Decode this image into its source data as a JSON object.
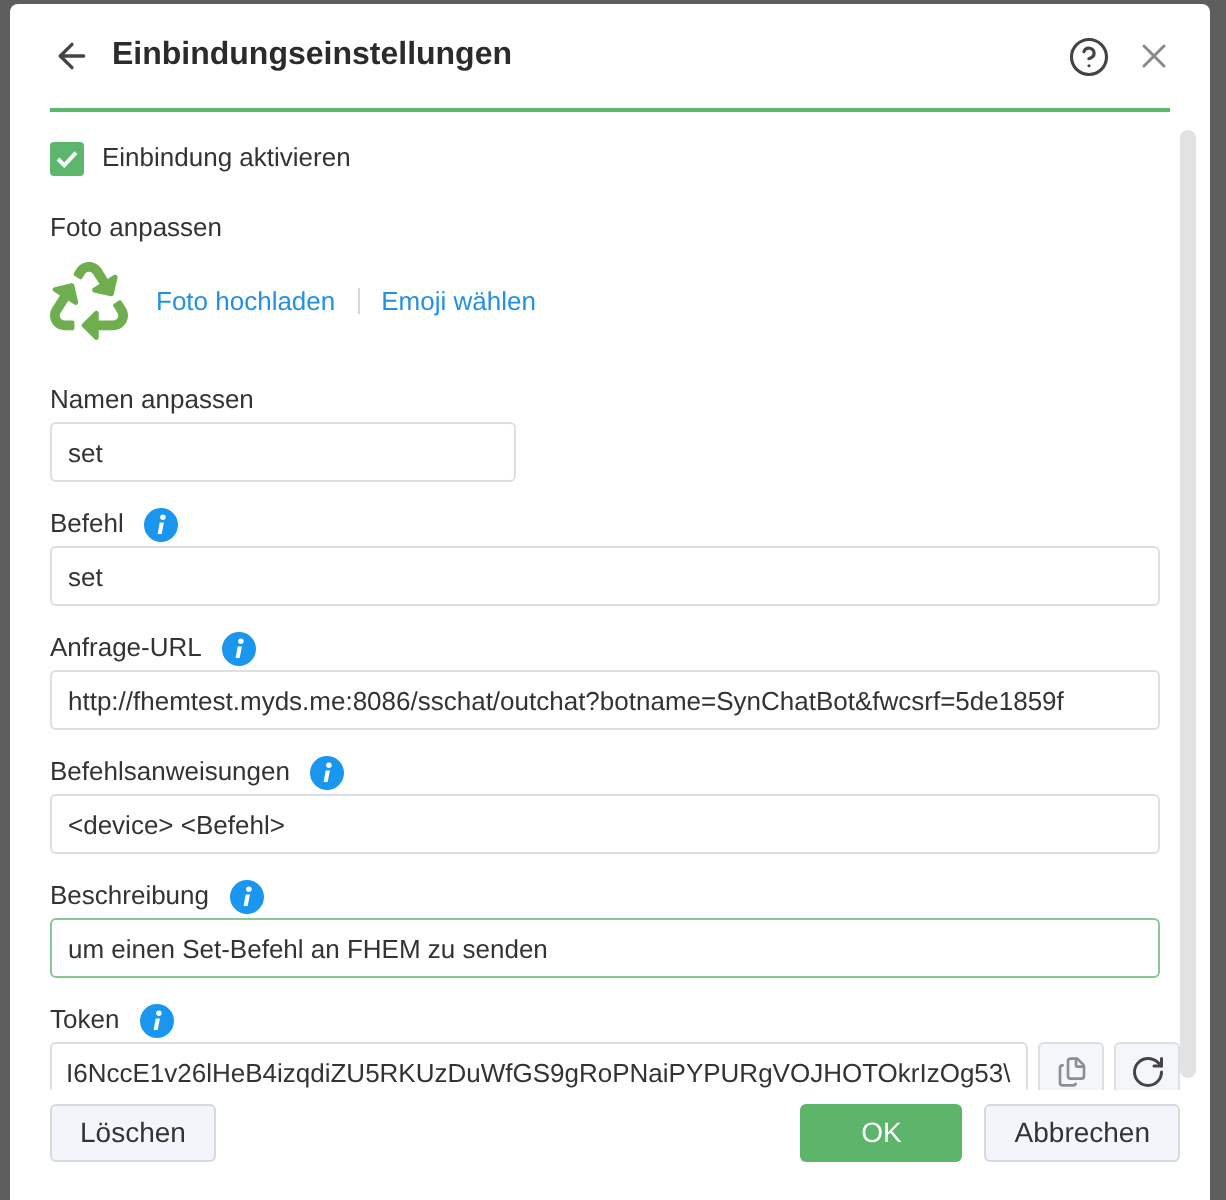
{
  "dialog": {
    "title": "Einbindungseinstellungen"
  },
  "enable": {
    "label": "Einbindung aktivieren",
    "checked": true
  },
  "photo": {
    "label": "Foto anpassen",
    "links": [
      "Foto hochladen",
      "Emoji wählen"
    ]
  },
  "fields": [
    {
      "label": "Namen anpassen",
      "kind": "short",
      "info": false,
      "focused": false,
      "value": "set"
    },
    {
      "label": "Befehl",
      "kind": "full",
      "info": true,
      "focused": false,
      "value": "set"
    },
    {
      "label": "Anfrage-URL",
      "kind": "full",
      "info": true,
      "focused": false,
      "value": "http://fhemtest.myds.me:8086/sschat/outchat?botname=SynChatBot&fwcsrf=5de1859f"
    },
    {
      "label": "Befehlsanweisungen",
      "kind": "full",
      "info": true,
      "focused": false,
      "value": "<device> <Befehl>"
    },
    {
      "label": "Beschreibung",
      "kind": "full",
      "info": true,
      "focused": true,
      "value": "um einen Set-Befehl an FHEM zu senden"
    },
    {
      "label": "Token",
      "kind": "token",
      "info": true,
      "focused": false,
      "value": "I6NccE1v26lHeB4izqdiZU5RKUzDuWfGS9gRoPNaiPYPURgVOJHOTOkrIzOg53\\"
    }
  ],
  "buttons": {
    "delete": "Löschen",
    "ok": "OK",
    "cancel": "Abbrechen"
  }
}
